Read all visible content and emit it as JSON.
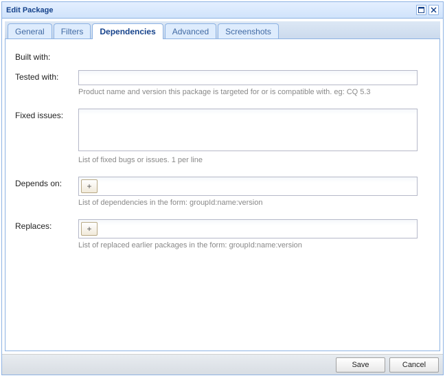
{
  "dialog": {
    "title": "Edit Package"
  },
  "tabs": {
    "general": "General",
    "filters": "Filters",
    "dependencies": "Dependencies",
    "advanced": "Advanced",
    "screenshots": "Screenshots"
  },
  "form": {
    "built_with": {
      "label": "Built with:"
    },
    "tested_with": {
      "label": "Tested with:",
      "value": "",
      "hint": "Product name and version this package is targeted for or is compatible with. eg: CQ 5.3"
    },
    "fixed_issues": {
      "label": "Fixed issues:",
      "value": "",
      "hint": "List of fixed bugs or issues. 1 per line"
    },
    "depends_on": {
      "label": "Depends on:",
      "hint": "List of dependencies in the form: groupId:name:version",
      "add_label": "+"
    },
    "replaces": {
      "label": "Replaces:",
      "hint": "List of replaced earlier packages in the form: groupId:name:version",
      "add_label": "+"
    }
  },
  "footer": {
    "save": "Save",
    "cancel": "Cancel"
  }
}
